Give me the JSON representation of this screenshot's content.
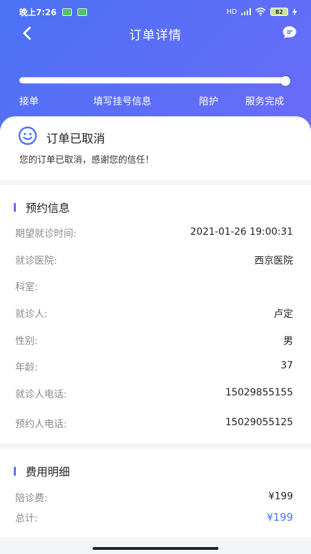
{
  "status_bar": {
    "time": "晚上7:26",
    "signal": "HD",
    "battery": "82"
  },
  "header": {
    "title": "订单详情"
  },
  "progress": {
    "fraction": 1.0,
    "steps": [
      "接单",
      "填写挂号信息",
      "陪护",
      "服务完成"
    ]
  },
  "order_status": {
    "title": "订单已取消",
    "description": "您的订单已取消，感谢您的信任！"
  },
  "appointment": {
    "section_title": "预约信息",
    "rows": [
      {
        "label": "期望就诊时间:",
        "value": "2021-01-26 19:00:31"
      },
      {
        "label": "就诊医院:",
        "value": "西京医院"
      },
      {
        "label": "科室:",
        "value": ""
      },
      {
        "label": "就诊人:",
        "value": "卢定"
      },
      {
        "label": "性别:",
        "value": "男"
      },
      {
        "label": "年龄:",
        "value": "37"
      },
      {
        "label": "就诊人电话:",
        "value": "15029855155"
      },
      {
        "label": "预约人电话:",
        "value": "15029055125"
      }
    ]
  },
  "fees": {
    "section_title": "费用明细",
    "rows": [
      {
        "label": "陪诊费:",
        "value": "¥199"
      },
      {
        "label": "总计:",
        "value": "¥199"
      }
    ]
  },
  "colors": {
    "primary": "#4a72f5",
    "gradient_end": "#6a6cf8",
    "accent_text": "#4a72f5"
  },
  "icons": {
    "back": "chevron-left-icon",
    "message": "chat-bubble-icon",
    "status": "smiley-face-icon"
  }
}
